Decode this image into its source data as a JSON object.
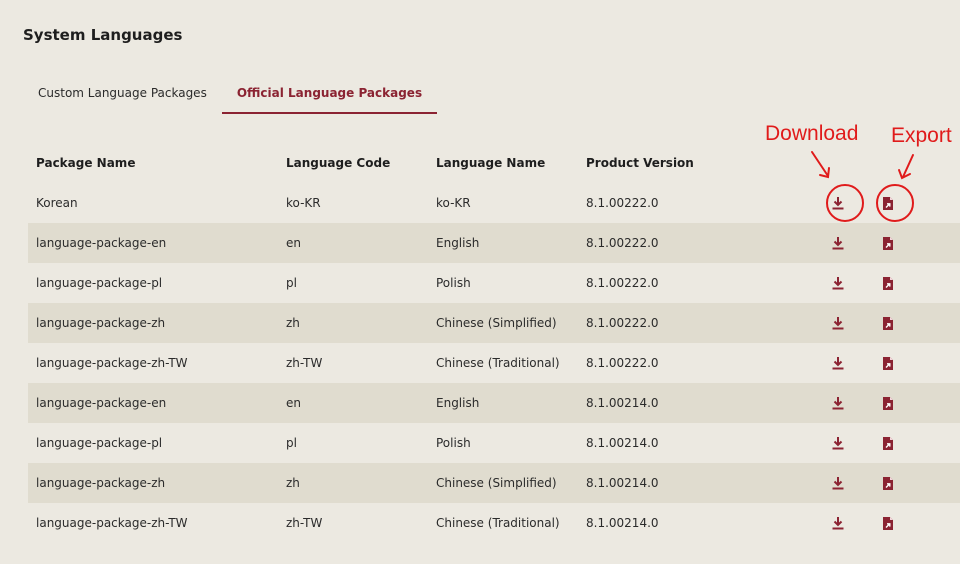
{
  "page": {
    "title": "System Languages"
  },
  "tabs": [
    {
      "label": "Custom Language Packages",
      "active": false
    },
    {
      "label": "Official Language Packages",
      "active": true
    }
  ],
  "table": {
    "columns": [
      "Package Name",
      "Language Code",
      "Language Name",
      "Product Version"
    ],
    "rows": [
      [
        "Korean",
        "ko-KR",
        "ko-KR",
        "8.1.00222.0"
      ],
      [
        "language-package-en",
        "en",
        "English",
        "8.1.00222.0"
      ],
      [
        "language-package-pl",
        "pl",
        "Polish",
        "8.1.00222.0"
      ],
      [
        "language-package-zh",
        "zh",
        "Chinese (Simplified)",
        "8.1.00222.0"
      ],
      [
        "language-package-zh-TW",
        "zh-TW",
        "Chinese (Traditional)",
        "8.1.00222.0"
      ],
      [
        "language-package-en",
        "en",
        "English",
        "8.1.00214.0"
      ],
      [
        "language-package-pl",
        "pl",
        "Polish",
        "8.1.00214.0"
      ],
      [
        "language-package-zh",
        "zh",
        "Chinese (Simplified)",
        "8.1.00214.0"
      ],
      [
        "language-package-zh-TW",
        "zh-TW",
        "Chinese (Traditional)",
        "8.1.00214.0"
      ]
    ],
    "row_actions": [
      "download-icon",
      "export-icon"
    ]
  },
  "annotations": {
    "download_label": "Download",
    "export_label": "Export",
    "color": "#e01b1b"
  },
  "colors": {
    "accent": "#8b2332",
    "background": "#ece9e1",
    "row_alt": "#e0dccf"
  }
}
